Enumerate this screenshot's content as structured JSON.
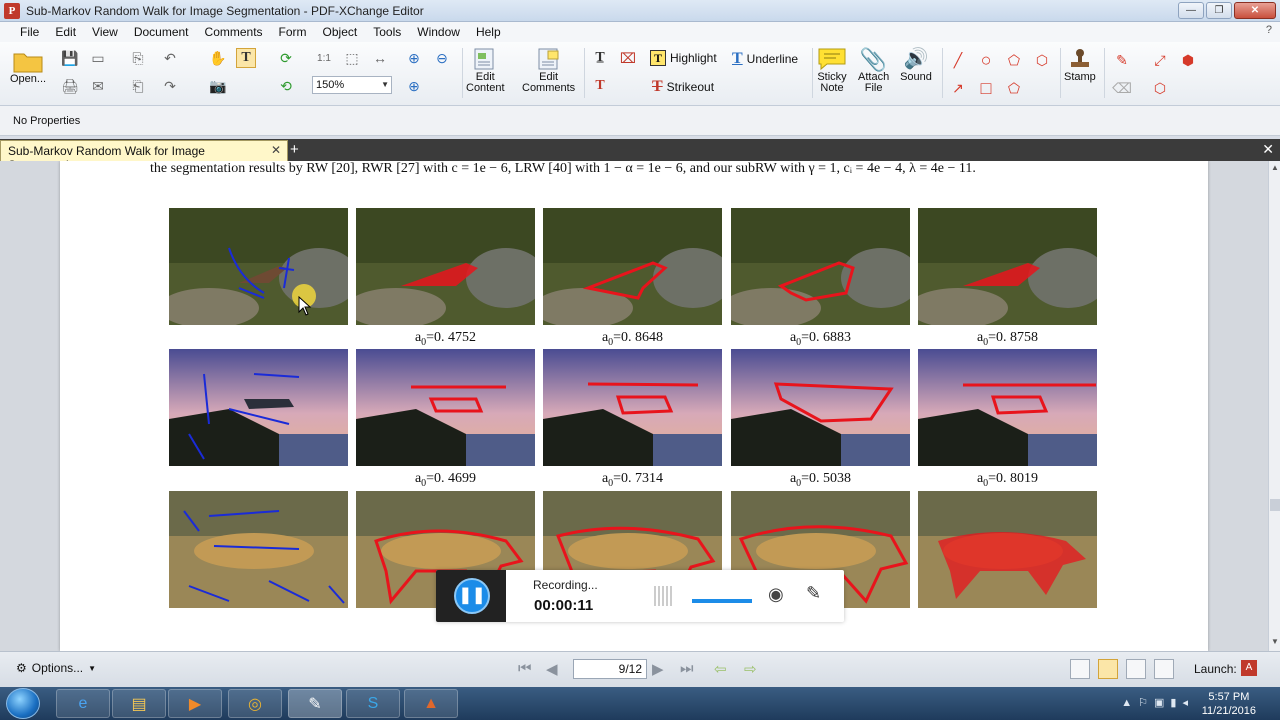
{
  "window": {
    "title": "Sub-Markov Random Walk for Image Segmentation - PDF-XChange Editor",
    "minimize": "—",
    "maximize": "❐",
    "close": "✕"
  },
  "menu": {
    "items": [
      "File",
      "Edit",
      "View",
      "Document",
      "Comments",
      "Form",
      "Object",
      "Tools",
      "Window",
      "Help"
    ],
    "help_icon": "?"
  },
  "toolbar": {
    "open": "Open...",
    "zoom_value": "150%",
    "edit_content": [
      "Edit",
      "Content"
    ],
    "edit_comments": [
      "Edit",
      "Comments"
    ],
    "highlight": "Highlight",
    "underline": "Underline",
    "strikeout": "Strikeout",
    "sticky_note": [
      "Sticky",
      "Note"
    ],
    "attach_file": [
      "Attach",
      "File"
    ],
    "sound": "Sound",
    "stamp": "Stamp"
  },
  "properties": {
    "label": "No Properties"
  },
  "tabs": {
    "active": "Sub-Markov Random Walk for Image Segmentation"
  },
  "document": {
    "caption": "the segmentation results by RW [20], RWR [27] with c = 1e − 6, LRW [40] with 1 − α = 1e − 6, and our subRW with γ = 1, cᵢ = 4e − 4, λ = 4e − 11.",
    "score_prefix": "a",
    "score_sub": "0",
    "rows": [
      {
        "name": "bird",
        "scores": [
          "=0. 4752",
          "=0. 8648",
          "=0. 6883",
          "=0. 8758"
        ]
      },
      {
        "name": "helicopter",
        "scores": [
          "=0. 4699",
          "=0. 7314",
          "=0. 5038",
          "=0. 8019"
        ]
      },
      {
        "name": "cheetah",
        "scores": [
          "",
          "",
          "",
          ""
        ]
      }
    ]
  },
  "recorder": {
    "status": "Recording...",
    "elapsed": "00:00:11",
    "volume": 0.6
  },
  "status": {
    "options": "Options...",
    "page_indicator": "9/12",
    "launch": "Launch:"
  },
  "clock": {
    "time": "5:57 PM",
    "date": "11/21/2016"
  },
  "colors": {
    "tab_active": "#fff7c9",
    "accent": "#1c8ce8",
    "seg_red": "#e8141c",
    "seed_blue": "#1a2bd8"
  }
}
